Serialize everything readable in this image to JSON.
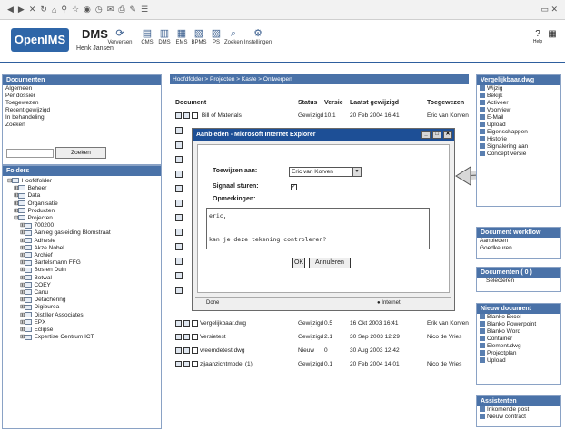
{
  "app": {
    "logo": "OpenIMS",
    "product": "DMS",
    "user": "Henk Jansen"
  },
  "toolbar": {
    "items": [
      {
        "label": "Verversen",
        "icon": "refresh-icon"
      },
      {
        "label": "CMS",
        "icon": "cms-icon"
      },
      {
        "label": "DMS",
        "icon": "dms-icon"
      },
      {
        "label": "EMS",
        "icon": "ems-icon"
      },
      {
        "label": "BPMS",
        "icon": "bpms-icon"
      },
      {
        "label": "PS",
        "icon": "ps-icon"
      },
      {
        "label": "Zoeken",
        "icon": "search-icon"
      },
      {
        "label": "Instellingen",
        "icon": "settings-icon"
      }
    ],
    "help": "Help"
  },
  "documents_panel": {
    "title": "Documenten",
    "links": [
      "Algemeen",
      "Per dossier",
      "Toegewezen",
      "Recent gewijzigd",
      "In behandeling",
      "Zoeken"
    ],
    "search_button": "Zoeken"
  },
  "folders_panel": {
    "title": "Folders",
    "tree": [
      {
        "label": "Hoofdfolder",
        "level": 0
      },
      {
        "label": "Beheer",
        "level": 1
      },
      {
        "label": "Data",
        "level": 1
      },
      {
        "label": "Organisatie",
        "level": 1
      },
      {
        "label": "Producten",
        "level": 1
      },
      {
        "label": "Projecten",
        "level": 1
      },
      {
        "label": "700200",
        "level": 2
      },
      {
        "label": "Aanleg gasleiding Blomstraat",
        "level": 2
      },
      {
        "label": "Adhesie",
        "level": 2
      },
      {
        "label": "Akze Nobel",
        "level": 2
      },
      {
        "label": "Archief",
        "level": 2
      },
      {
        "label": "Bartelsmann FFG",
        "level": 2
      },
      {
        "label": "Bos en Duin",
        "level": 2
      },
      {
        "label": "Botwal",
        "level": 2
      },
      {
        "label": "COEY",
        "level": 2
      },
      {
        "label": "Canu",
        "level": 2
      },
      {
        "label": "Detachering",
        "level": 2
      },
      {
        "label": "Digiburea",
        "level": 2
      },
      {
        "label": "Distiller Associates",
        "level": 2
      },
      {
        "label": "EPX",
        "level": 2
      },
      {
        "label": "Eclipse",
        "level": 2
      },
      {
        "label": "Expertise Centrum ICT",
        "level": 2
      }
    ]
  },
  "breadcrumb": "Hoofdfolder > Projecten > Kaste > Ontwerpen",
  "files": {
    "headers": [
      "Document",
      "Status",
      "Versie",
      "Laatst gewijzigd",
      "Toegewezen"
    ],
    "top_row": {
      "name": "Bill of Materials",
      "status": "Gewijzigd",
      "version": "10.1",
      "date": "20 Feb 2004 16:41",
      "assigned": "Eric van Korven"
    },
    "rows": [
      {
        "name": "Vergelijkbaar.dwg",
        "status": "Gewijzigd",
        "version": "0.5",
        "date": "16 Okt 2003 16:41",
        "assigned": "Erik van Korven"
      },
      {
        "name": "Versietest",
        "status": "Gewijzigd",
        "version": "2.1",
        "date": "30 Sep 2003 12:29",
        "assigned": "Nico de Vries"
      },
      {
        "name": "vreemdetest.dwg",
        "status": "Nieuw",
        "version": "0",
        "date": "30 Aug 2003 12:42",
        "assigned": ""
      },
      {
        "name": "zijaanzichtmodel (1)",
        "status": "Gewijzigd",
        "version": "0.1",
        "date": "20 Feb 2004 14:01",
        "assigned": "Nico de Vries"
      }
    ]
  },
  "dialog": {
    "title": "Aanbieden - Microsoft Internet Explorer",
    "assign_label": "Toewijzen aan:",
    "assign_value": "Eric van Korven",
    "signal_label": "Signaal sturen:",
    "signal_checked": "✓",
    "remarks_label": "Opmerkingen:",
    "remarks_text": "eric,\n\nkan je deze tekening controleren?",
    "ok": "OK",
    "cancel": "Annuleren",
    "status_left": "Done",
    "status_right": "Internet"
  },
  "right_panels": {
    "vergelijkbaar": {
      "title": "Vergelijkbaar.dwg",
      "items": [
        "Wijzig",
        "Bekijk",
        "Activeer",
        "Voorview",
        "E-Mail",
        "Upload",
        "Eigenschappen",
        "Historie",
        "Signalering aan",
        "Concept versie"
      ]
    },
    "workflow": {
      "title": "Document workflow",
      "items": [
        "Aanbieden",
        "Goedkeuren"
      ]
    },
    "documenten": {
      "title": "Documenten ( 0 )",
      "items": [
        "Selecteren"
      ]
    },
    "nieuw": {
      "title": "Nieuw document",
      "items": [
        "Blanko Excel",
        "Blanko Powerpoint",
        "Blanko Word",
        "Container",
        "Element.dwg",
        "Projectplan",
        "Upload"
      ]
    },
    "assistenten": {
      "title": "Assistenten",
      "items": [
        "Inkomende post",
        "Nieuw contract"
      ]
    }
  },
  "colors": {
    "accent": "#2f66a8",
    "panel_header": "#4a72a8",
    "dialog_title": "#1d4f96"
  }
}
